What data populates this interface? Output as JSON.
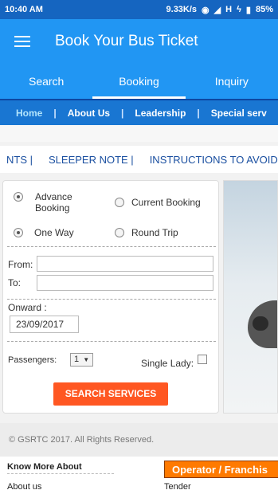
{
  "status_bar": {
    "time": "10:40 AM",
    "speed": "9.33K/s",
    "network": "H",
    "battery": "85%"
  },
  "app": {
    "title": "Book Your Bus Ticket"
  },
  "tabs": [
    {
      "label": "Search"
    },
    {
      "label": "Booking",
      "active": true
    },
    {
      "label": "Inquiry"
    }
  ],
  "menu": {
    "items": [
      "Home",
      "About Us",
      "Leadership",
      "Special serv"
    ],
    "separator": "|"
  },
  "marquee": [
    "NTS |",
    "SLEEPER NOTE |",
    "INSTRUCTIONS TO AVOID FA"
  ],
  "booking": {
    "advance_label": "Advance Booking",
    "current_label": "Current Booking",
    "one_way_label": "One Way",
    "round_trip_label": "Round Trip",
    "from_label": "From:",
    "to_label": "To:",
    "from_value": "",
    "to_value": "",
    "onward_label": "Onward :",
    "onward_date": "23/09/2017",
    "passengers_label": "Passengers:",
    "passengers_value": "1",
    "single_lady_label": "Single Lady:",
    "search_button": "SEARCH SERVICES"
  },
  "footer": {
    "copyright": "© GSRTC 2017. All Rights Reserved.",
    "know_more": "Know More About",
    "about_us": "About us",
    "operator": "Operator / Franchis",
    "tender": "Tender"
  },
  "colors": {
    "primary": "#2196f3",
    "dark_primary": "#1565c0",
    "menu": "#1976d2",
    "button": "#ff5722",
    "operator": "#ff7a00"
  }
}
